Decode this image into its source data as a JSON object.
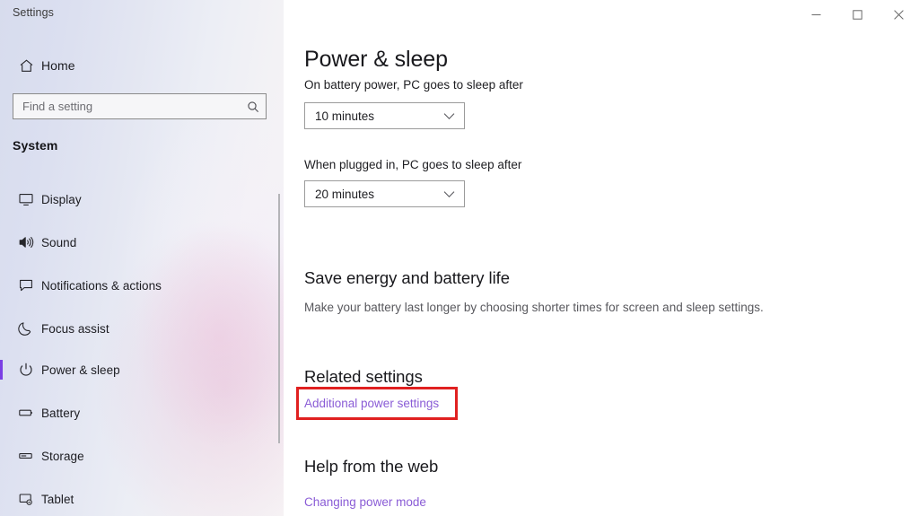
{
  "window": {
    "title": "Settings",
    "controls": [
      {
        "name": "minimize",
        "glyph": "─"
      },
      {
        "name": "maximize",
        "glyph": "□"
      },
      {
        "name": "close",
        "glyph": "✕"
      }
    ]
  },
  "sidebar": {
    "home_label": "Home",
    "home_icon": "home-icon",
    "search": {
      "placeholder": "Find a setting",
      "value": "",
      "icon": "search-icon"
    },
    "section_label": "System",
    "items": [
      {
        "label": "Display",
        "icon": "monitor-icon",
        "selected": false
      },
      {
        "label": "Sound",
        "icon": "speaker-icon",
        "selected": false
      },
      {
        "label": "Notifications & actions",
        "icon": "chat-bubble-icon",
        "selected": false
      },
      {
        "label": "Focus assist",
        "icon": "moon-icon",
        "selected": false
      },
      {
        "label": "Power & sleep",
        "icon": "power-icon",
        "selected": true
      },
      {
        "label": "Battery",
        "icon": "battery-icon",
        "selected": false
      },
      {
        "label": "Storage",
        "icon": "drive-icon",
        "selected": false
      },
      {
        "label": "Tablet",
        "icon": "tablet-icon",
        "selected": false
      }
    ],
    "accent_color": "#7b3fe4"
  },
  "main": {
    "page_title": "Power & sleep",
    "sleep_on_battery": {
      "label": "On battery power, PC goes to sleep after",
      "value": "10 minutes"
    },
    "sleep_plugged_in": {
      "label": "When plugged in, PC goes to sleep after",
      "value": "20 minutes"
    },
    "save_energy": {
      "heading": "Save energy and battery life",
      "description": "Make your battery last longer by choosing shorter times for screen and sleep settings."
    },
    "related_settings": {
      "heading": "Related settings",
      "link": "Additional power settings"
    },
    "help_from_web": {
      "heading": "Help from the web",
      "link": "Changing power mode"
    },
    "link_color": "#8a5cd6",
    "highlight_color": "#e02020"
  }
}
